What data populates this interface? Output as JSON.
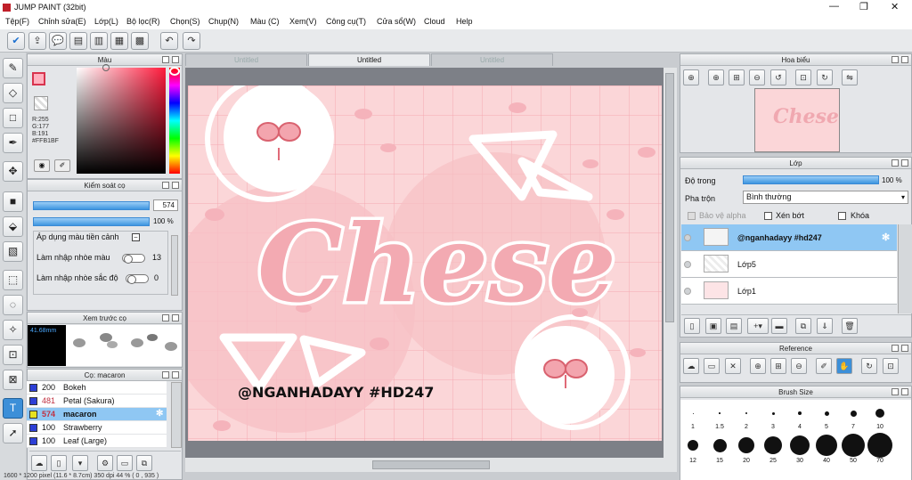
{
  "titlebar": {
    "title": "JUMP PAINT (32bit)",
    "minimize": "—",
    "restore": "❐",
    "close": "✕"
  },
  "menu": [
    "Tệp(F)",
    "Chỉnh sửa(E)",
    "Lớp(L)",
    "Bộ lọc(R)",
    "Chọn(S)",
    "Chụp(N)",
    "Màu (C)",
    "Xem(V)",
    "Công cụ(T)",
    "Cửa sổ(W)",
    "Cloud",
    "Help"
  ],
  "color_panel": {
    "title": "Màu",
    "r": "R:255",
    "g": "G:177",
    "b": "B:191",
    "hex": "#FFB1BF",
    "fg": "#ffb1bf"
  },
  "brush_control": {
    "title": "Kiểm soát cọ",
    "size": "574",
    "opacity": "100 %",
    "apply_label": "Áp dụng màu tiền cảnh",
    "blend_color_label": "Làm nhập nhòe màu",
    "blend_color_value": "13",
    "blend_sat_label": "Làm nhập nhòe sắc độ",
    "blend_sat_value": "0"
  },
  "brush_preview": {
    "title": "Xem trước cọ",
    "size": "41.68mm"
  },
  "brush_list": {
    "title": "Cọ: macaron",
    "items": [
      {
        "size": "200",
        "name": "Bokeh",
        "color": "#2d3fd6",
        "selected": false
      },
      {
        "size": "481",
        "name": "Petal (Sakura)",
        "color": "#2d3fd6",
        "selected": false
      },
      {
        "size": "574",
        "name": "macaron",
        "color": "#e6e21e",
        "selected": true
      },
      {
        "size": "100",
        "name": "Strawberry",
        "color": "#2d3fd6",
        "selected": false
      },
      {
        "size": "100",
        "name": "Leaf (Large)",
        "color": "#2d3fd6",
        "selected": false
      }
    ]
  },
  "tabs": [
    "Untitled",
    "Untitled",
    "Untitled"
  ],
  "artwork": {
    "title": "Chese",
    "caption": "@NGANHADAYY #HD247"
  },
  "navigator": {
    "title": "Hoa biểu"
  },
  "layers": {
    "title": "Lớp",
    "opacity_label": "Độ trong",
    "opacity_value": "100 %",
    "blend_label": "Pha trộn",
    "blend_value": "Bình thường",
    "protect_alpha": "Bảo vệ alpha",
    "clip": "Xén bớt",
    "lock": "Khóa",
    "items": [
      {
        "name": "@nganhadayy #hd247",
        "selected": true
      },
      {
        "name": "Lớp5",
        "selected": false
      },
      {
        "name": "Lớp1",
        "selected": false
      }
    ]
  },
  "reference": {
    "title": "Reference"
  },
  "brush_size": {
    "title": "Brush Size",
    "row1": [
      "1",
      "1.5",
      "2",
      "3",
      "4",
      "5",
      "7",
      "10"
    ],
    "row2": [
      "12",
      "15",
      "20",
      "25",
      "30",
      "40",
      "50",
      "70"
    ]
  },
  "status": "1600 * 1200 pixel  (11.6 * 8.7cm)  350 dpi  44 %  ( 0 , 935 )"
}
